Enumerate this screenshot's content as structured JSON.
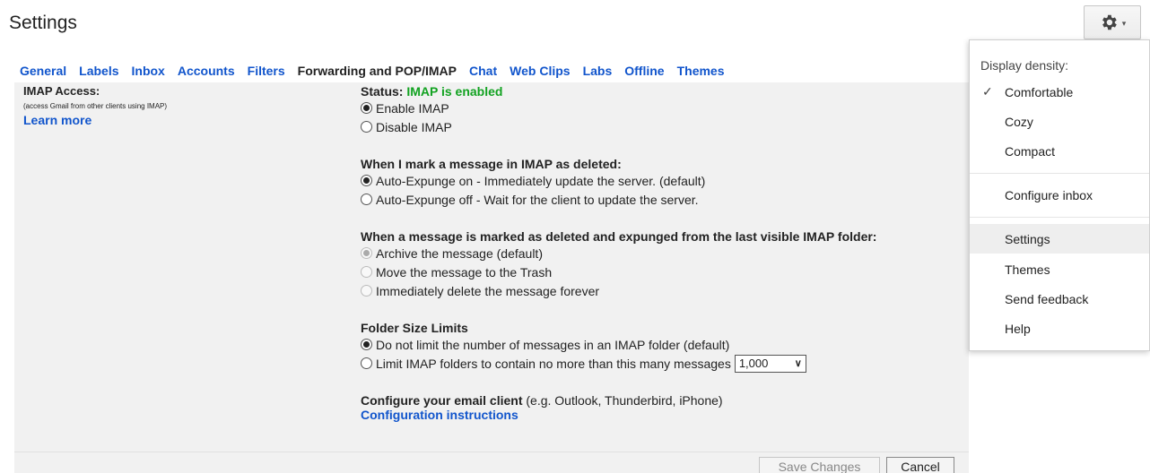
{
  "page": {
    "title": "Settings"
  },
  "gear": {
    "icon": "gear-icon",
    "caret": "▾"
  },
  "tabs": [
    {
      "label": "General"
    },
    {
      "label": "Labels"
    },
    {
      "label": "Inbox"
    },
    {
      "label": "Accounts"
    },
    {
      "label": "Filters"
    },
    {
      "label": "Forwarding and POP/IMAP",
      "active": true
    },
    {
      "label": "Chat"
    },
    {
      "label": "Web Clips"
    },
    {
      "label": "Labs"
    },
    {
      "label": "Offline"
    },
    {
      "label": "Themes"
    }
  ],
  "imap": {
    "title": "IMAP Access:",
    "subtitle": "(access Gmail from other clients using IMAP)",
    "learn_more": "Learn more",
    "status_label": "Status:",
    "status_value": "IMAP is enabled",
    "enable": "Enable IMAP",
    "disable": "Disable IMAP",
    "selected": "enable"
  },
  "deleted": {
    "title": "When I mark a message in IMAP as deleted:",
    "opt_on": "Auto-Expunge on - Immediately update the server. (default)",
    "opt_off": "Auto-Expunge off - Wait for the client to update the server.",
    "selected": "on"
  },
  "expunged": {
    "title": "When a message is marked as deleted and expunged from the last visible IMAP folder:",
    "archive": "Archive the message (default)",
    "trash": "Move the message to the Trash",
    "forever": "Immediately delete the message forever",
    "selected": "archive"
  },
  "folder_limits": {
    "title": "Folder Size Limits",
    "no_limit": "Do not limit the number of messages in an IMAP folder (default)",
    "limit": "Limit IMAP folders to contain no more than this many messages",
    "limit_value": "1,000",
    "selected": "no_limit"
  },
  "configure": {
    "title": "Configure your email client",
    "hint": "(e.g. Outlook, Thunderbird, iPhone)",
    "link": "Configuration instructions"
  },
  "buttons": {
    "save": "Save Changes",
    "cancel": "Cancel"
  },
  "menu": {
    "header": "Display density:",
    "comfortable": "Comfortable",
    "cozy": "Cozy",
    "compact": "Compact",
    "configure_inbox": "Configure inbox",
    "settings": "Settings",
    "themes": "Themes",
    "send_feedback": "Send feedback",
    "help": "Help",
    "checked": "comfortable",
    "check_glyph": "✓"
  }
}
